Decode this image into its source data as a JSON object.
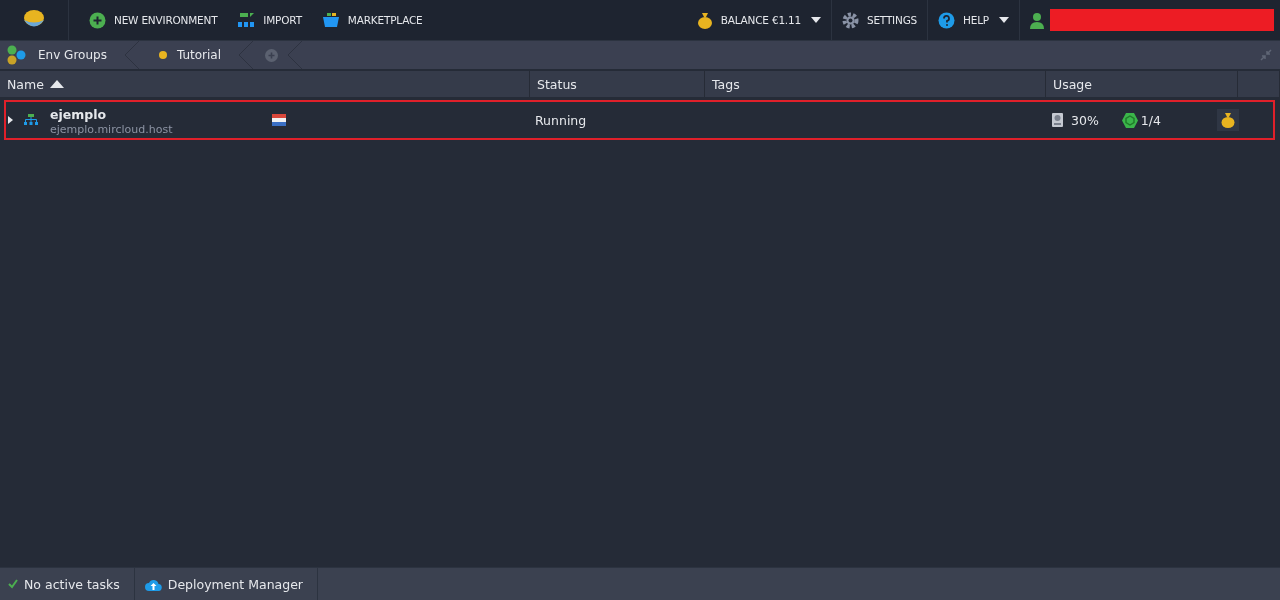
{
  "toolbar": {
    "new_environment": "NEW ENVIRONMENT",
    "import": "IMPORT",
    "marketplace": "MARKETPLACE",
    "balance": "BALANCE €1.11",
    "settings": "SETTINGS",
    "help": "HELP"
  },
  "breadcrumbs": [
    {
      "label": "Env Groups",
      "kind": "root"
    },
    {
      "label": "Tutorial",
      "kind": "group"
    }
  ],
  "table": {
    "columns": [
      {
        "label": "Name",
        "sorted": true
      },
      {
        "label": "Status",
        "sorted": false
      },
      {
        "label": "Tags",
        "sorted": false
      },
      {
        "label": "Usage",
        "sorted": false
      }
    ],
    "rows": [
      {
        "name": "ejemplo",
        "domain": "ejemplo.mircloud.host",
        "status": "Running",
        "disk": "30%",
        "nodes": "1/4",
        "selected": true,
        "expanded": false
      }
    ]
  },
  "status_bar": {
    "tasks": "No active tasks",
    "deployment_manager": "Deployment Manager"
  }
}
